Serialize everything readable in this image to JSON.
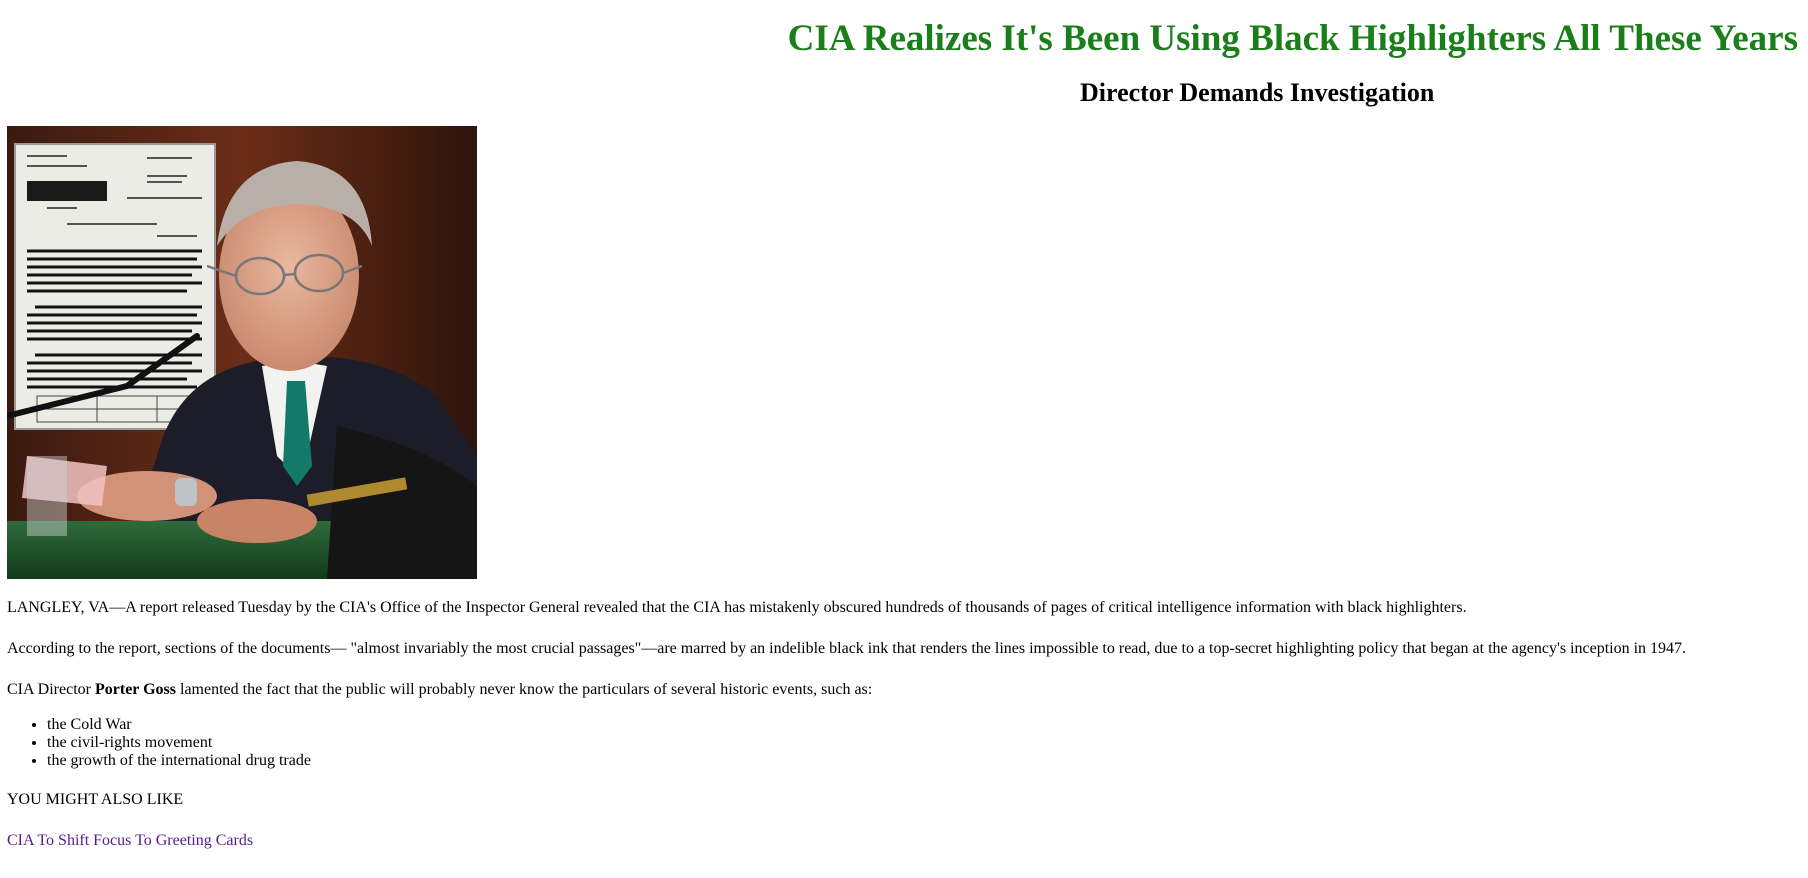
{
  "headline": {
    "title": "CIA Realizes It's Been Using Black Highlighters All These Years",
    "color": "#1a7f1a"
  },
  "subheadline": "Director Demands Investigation",
  "image": {
    "name": "cia-director-hearing-photo"
  },
  "article": {
    "paragraph1": "LANGLEY, VA—A report released Tuesday by the CIA's Office of the Inspector General revealed that the CIA has mistakenly obscured hundreds of thousands of pages of critical intelligence information with black highlighters.",
    "paragraph2": "According to the report, sections of the documents— \"almost invariably the most crucial passages\"—are marred by an indelible black ink that renders the lines impossible to read, due to a top-secret highlighting policy that began at the agency's inception in 1947.",
    "paragraph3_prefix": "CIA Director ",
    "paragraph3_name": "Porter Goss",
    "paragraph3_suffix": " lamented the fact that the public will probably never know the particulars of several historic events, such as:",
    "events": [
      "the Cold War",
      "the civil-rights movement",
      "the growth of the international drug trade"
    ]
  },
  "related": {
    "heading": "YOU MIGHT ALSO LIKE",
    "link_label": "CIA To Shift Focus To Greeting Cards",
    "link_color": "#551a8b"
  }
}
